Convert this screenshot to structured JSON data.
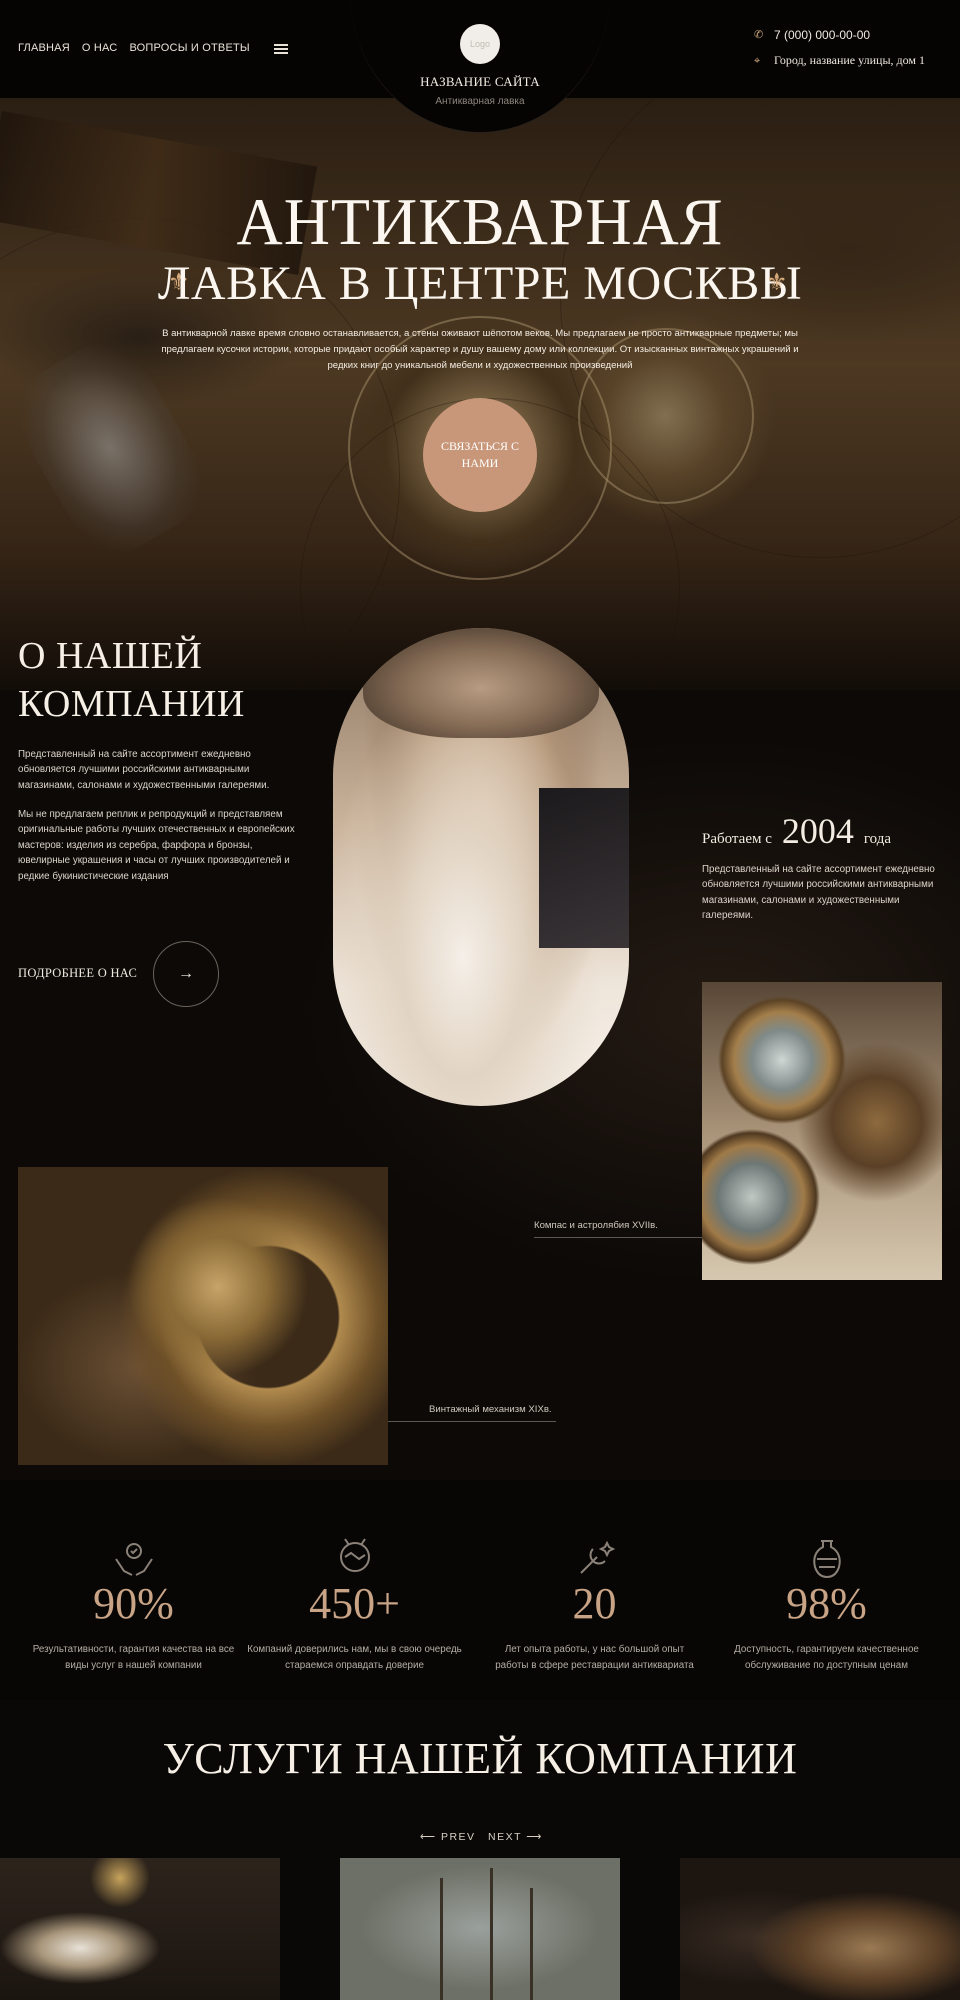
{
  "header": {
    "nav": [
      "ГЛАВНАЯ",
      "О НАС",
      "ВОПРОСЫ И ОТВЕТЫ"
    ],
    "logo_text": "Logo",
    "site_name": "НАЗВАНИЕ САЙТА",
    "site_subtitle": "Антикварная лавка",
    "phone": "7 (000) 000-00-00",
    "address": "Город, название улицы, дом 1"
  },
  "hero": {
    "title_line1": "АНТИКВАРНАЯ",
    "title_line2": "ЛАВКА В ЦЕНТРЕ МОСКВЫ",
    "fleur": "⚜",
    "text": "В антикварной лавке время словно останавливается, а стены оживают шёпотом веков. Мы предлагаем не просто антикварные предметы; мы предлагаем кусочки истории, которые придают особый характер и душу вашему дому или коллекции. От изысканных винтажных украшений и редких книг до уникальной мебели и художественных произведений",
    "cta": "СВЯЗАТЬСЯ С НАМИ"
  },
  "about": {
    "title_line1": "О НАШЕЙ",
    "title_line2": "КОМПАНИИ",
    "p1": "Представленный на сайте ассортимент ежедневно обновляется лучшими российскими антикварными магазинами, салонами и художественными галереями.",
    "p2": "Мы не предлагаем реплик и репродукций и представляем оригинальные работы лучших отечественных и европейских мастеров: изделия из серебра, фарфора и бронзы, ювелирные украшения и часы от лучших производителей и редкие букинистические издания",
    "more": "ПОДРОБНЕЕ О НАС",
    "arrow": "→",
    "since_prefix": "Работаем с",
    "since_year": "2004",
    "since_suffix": "года",
    "since_text": "Представленный на сайте ассортимент ежедневно обновляется лучшими российскими антикварными магазинами, салонами и художественными галереями.",
    "caption_compass": "Компас и астролябия  XVIIв.",
    "caption_mechanism": "Винтажный механизм XIXв."
  },
  "stats": [
    {
      "icon": "hands-icon",
      "value": "90%",
      "text": "Результативности, гарантия качества на все виды услуг в нашей компании"
    },
    {
      "icon": "handshake-icon",
      "value": "450+",
      "text": "Компаний доверились нам, мы в свою очередь стараемся оправдать доверие"
    },
    {
      "icon": "tools-icon",
      "value": "20",
      "text": "Лет опыта работы, у нас большой опыт работы в сфере реставрации антиквариата"
    },
    {
      "icon": "vase-icon",
      "value": "98%",
      "text": "Доступность, гарантируем качественное обслуживание по доступным ценам"
    }
  ],
  "services": {
    "title": "УСЛУГИ НАШЕЙ КОМПАНИИ",
    "prev": "⟵ PREV",
    "next": "NEXT ⟶"
  },
  "colors": {
    "accent": "#c8977a",
    "stat_numbers": "#c8a385",
    "background": "#0a0806"
  }
}
